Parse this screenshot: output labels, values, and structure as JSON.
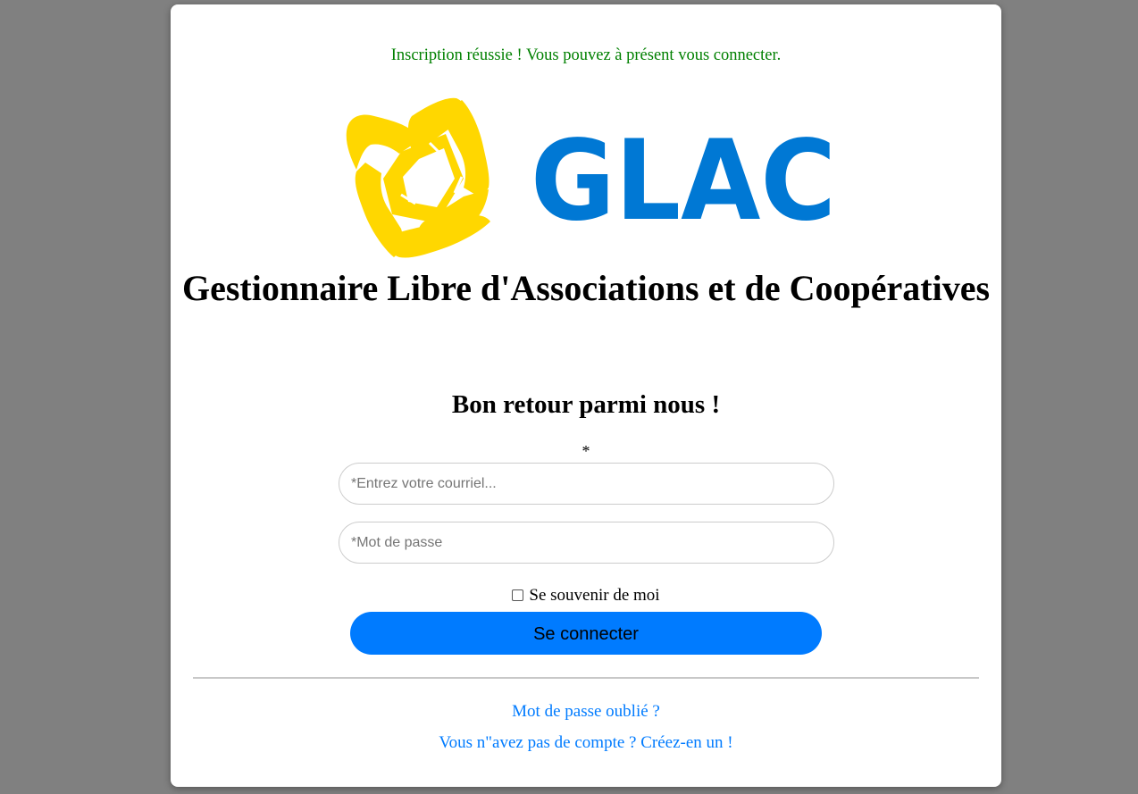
{
  "messages": {
    "success": "Inscription réussie ! Vous pouvez à présent vous connecter."
  },
  "logo": {
    "text": "GLAC",
    "text_color": "#0078d4",
    "emblem_color": "#ffd700"
  },
  "header": {
    "title": "Gestionnaire Libre d'Associations et de Coopératives",
    "welcome": "Bon retour parmi nous !"
  },
  "form": {
    "required_marker": "*",
    "email_placeholder": "*Entrez votre courriel...",
    "email_value": "",
    "password_placeholder": "*Mot de passe",
    "password_value": "",
    "remember_label": "Se souvenir de moi",
    "remember_checked": false,
    "submit_label": "Se connecter"
  },
  "links": {
    "forgot_password": "Mot de passe oublié ?",
    "signup": "Vous n\"avez pas de compte ? Créez-en un !"
  },
  "colors": {
    "background": "#808080",
    "card": "#ffffff",
    "success": "#008000",
    "accent": "#007bff"
  }
}
